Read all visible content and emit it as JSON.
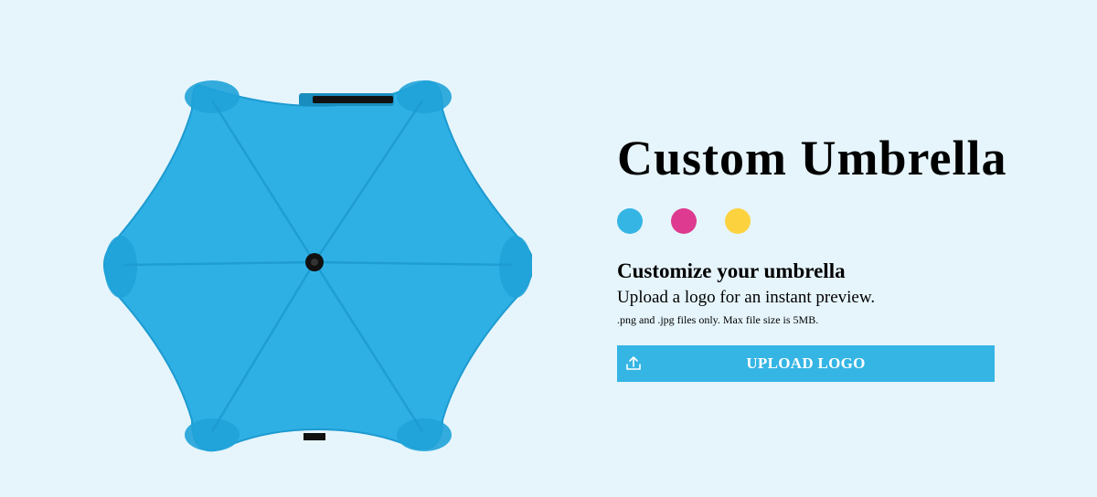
{
  "product": {
    "title": "Custom Umbrella",
    "colors": [
      {
        "name": "blue",
        "hex": "#35b5e4"
      },
      {
        "name": "pink",
        "hex": "#dd3a90"
      },
      {
        "name": "yellow",
        "hex": "#fcd23f"
      }
    ],
    "selected_color": "#35b5e4"
  },
  "customize": {
    "heading": "Customize your umbrella",
    "description": "Upload a logo for an instant preview.",
    "note": ".png and .jpg files only. Max file size is 5MB.",
    "upload_label": "UPLOAD LOGO",
    "upload_icon": "upload-icon"
  }
}
